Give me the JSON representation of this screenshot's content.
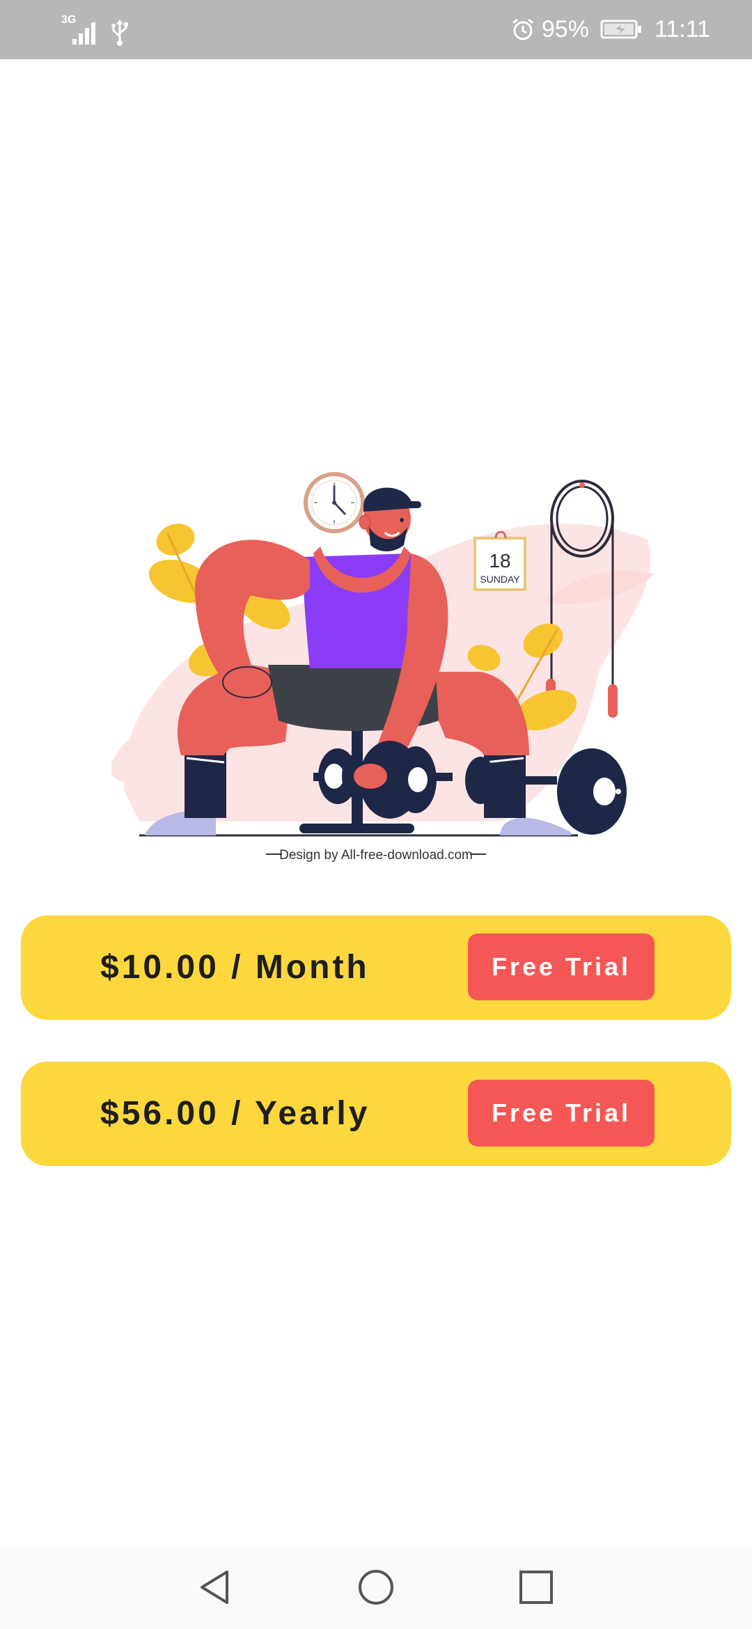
{
  "status_bar": {
    "network": "3G",
    "battery": "95%",
    "time": "11:11",
    "icons": [
      "signal-icon",
      "usb-icon",
      "alarm-icon",
      "battery-icon"
    ]
  },
  "illustration": {
    "calendar_day": "18",
    "calendar_weekday": "SUNDAY",
    "credit": "Design by All-free-download.com",
    "colors": {
      "skin": "#e8605a",
      "tank": "#8b3cf6",
      "leaf": "#f7c531",
      "dark": "#1f2747",
      "blob": "#fce3e3"
    }
  },
  "plans": [
    {
      "price": "$10.00 / Month",
      "button": "Free Trial"
    },
    {
      "price": "$56.00 / Yearly",
      "button": "Free Trial"
    }
  ],
  "colors": {
    "card": "#fdd73e",
    "button": "#f45755",
    "status_bar": "#b7b7b7"
  },
  "nav_bar": {
    "icons": [
      "back-icon",
      "home-icon",
      "recents-icon"
    ]
  }
}
